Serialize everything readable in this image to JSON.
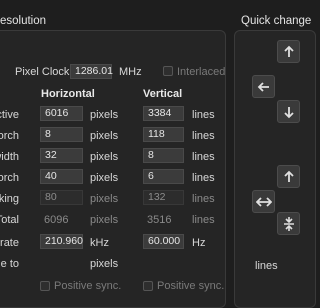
{
  "header": {
    "left_title": "esolution",
    "right_title": "Quick change"
  },
  "pixel_clock": {
    "label": "Pixel Clock:",
    "value": "1286.01",
    "unit": "MHz",
    "interlaced_label": "Interlaced"
  },
  "columns": {
    "horizontal": "Horizontal",
    "vertical": "Vertical"
  },
  "rows": [
    {
      "label": "ctive",
      "h": "6016",
      "h_unit": "pixels",
      "v": "3384",
      "v_unit": "lines",
      "editable": true
    },
    {
      "label": "orch",
      "h": "8",
      "h_unit": "pixels",
      "v": "118",
      "v_unit": "lines",
      "editable": true
    },
    {
      "label": "width",
      "h": "32",
      "h_unit": "pixels",
      "v": "8",
      "v_unit": "lines",
      "editable": true
    },
    {
      "label": "orch",
      "h": "40",
      "h_unit": "pixels",
      "v": "6",
      "v_unit": "lines",
      "editable": true
    },
    {
      "label": "nking",
      "h": "80",
      "h_unit": "pixels",
      "v": "132",
      "v_unit": "lines",
      "editable": false
    },
    {
      "label": "Total",
      "h": "6096",
      "h_unit": "pixels",
      "v": "3516",
      "v_unit": "lines",
      "editable": false
    },
    {
      "label": "rate",
      "h": "210.960",
      "h_unit": "kHz",
      "v": "60.000",
      "v_unit": "Hz",
      "editable": true
    }
  ],
  "scale_row": {
    "label": "le to",
    "h_unit": "pixels",
    "v_unit": "lines"
  },
  "positive_sync": {
    "h_label": "Positive sync.",
    "v_label": "Positive sync."
  },
  "quick_change": {
    "lines_label": "lines",
    "icons": [
      "arrow-up-icon",
      "arrow-left-icon",
      "arrow-down-icon",
      "arrow-left-right-icon",
      "arrows-inward-icon"
    ]
  }
}
